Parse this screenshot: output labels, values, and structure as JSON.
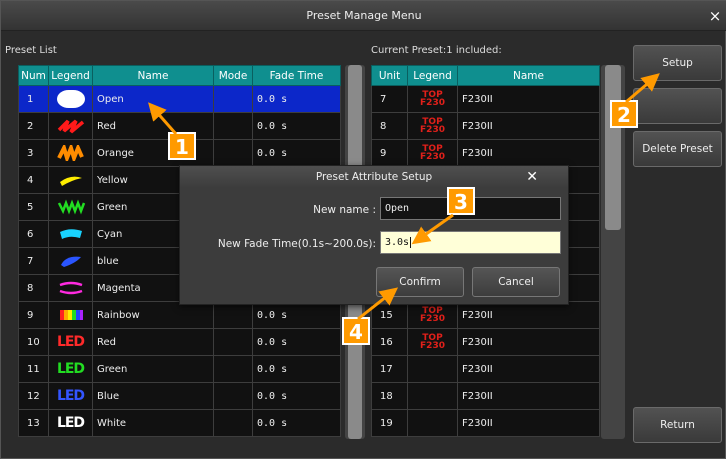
{
  "window": {
    "title": "Preset Manage Menu",
    "close": "×"
  },
  "preset_list": {
    "label": "Preset List",
    "columns": [
      "Num",
      "Legend",
      "Name",
      "Mode",
      "Fade Time"
    ],
    "rows": [
      {
        "num": "1",
        "legend": "white-blob",
        "name": "Open",
        "mode": "",
        "fade": "0.0 s"
      },
      {
        "num": "2",
        "legend": "red-scribble",
        "name": "Red",
        "mode": "",
        "fade": "0.0 s"
      },
      {
        "num": "3",
        "legend": "orange-brush",
        "name": "Orange",
        "mode": "",
        "fade": "0.0 s"
      },
      {
        "num": "4",
        "legend": "yellow-brush",
        "name": "Yellow",
        "mode": "",
        "fade": ""
      },
      {
        "num": "5",
        "legend": "green-scribble",
        "name": "Green",
        "mode": "",
        "fade": ""
      },
      {
        "num": "6",
        "legend": "cyan-brush",
        "name": "Cyan",
        "mode": "",
        "fade": ""
      },
      {
        "num": "7",
        "legend": "blue-brush",
        "name": "blue",
        "mode": "",
        "fade": ""
      },
      {
        "num": "8",
        "legend": "magenta-lips",
        "name": "Magenta",
        "mode": "",
        "fade": ""
      },
      {
        "num": "9",
        "legend": "rainbow",
        "name": "Rainbow",
        "mode": "",
        "fade": "0.0 s"
      },
      {
        "num": "10",
        "legend": "LED",
        "name": "Red",
        "mode": "",
        "fade": "0.0 s"
      },
      {
        "num": "11",
        "legend": "LED",
        "name": "Green",
        "mode": "",
        "fade": "0.0 s"
      },
      {
        "num": "12",
        "legend": "LED",
        "name": "Blue",
        "mode": "",
        "fade": "0.0 s"
      },
      {
        "num": "13",
        "legend": "LED",
        "name": "White",
        "mode": "",
        "fade": "0.0 s"
      }
    ],
    "legend_colors": {
      "red": "#ff2a2a",
      "green": "#22dd22",
      "blue": "#3355ff",
      "white": "#ffffff"
    }
  },
  "current_preset": {
    "label": "Current Preset:1 included:",
    "columns": [
      "Unit",
      "Legend",
      "Name"
    ],
    "rows": [
      {
        "unit": "7",
        "legend": "TOP F230",
        "name": "F230II"
      },
      {
        "unit": "8",
        "legend": "TOP F230",
        "name": "F230II"
      },
      {
        "unit": "9",
        "legend": "TOP F230",
        "name": "F230II"
      },
      {
        "unit": "",
        "legend": "",
        "name": ""
      },
      {
        "unit": "",
        "legend": "",
        "name": ""
      },
      {
        "unit": "",
        "legend": "",
        "name": ""
      },
      {
        "unit": "",
        "legend": "",
        "name": ""
      },
      {
        "unit": "",
        "legend": "",
        "name": ""
      },
      {
        "unit": "15",
        "legend": "TOP F230",
        "name": "F230II"
      },
      {
        "unit": "16",
        "legend": "TOP F230",
        "name": "F230II"
      },
      {
        "unit": "17",
        "legend": "",
        "name": "F230II"
      },
      {
        "unit": "18",
        "legend": "",
        "name": "F230II"
      },
      {
        "unit": "19",
        "legend": "",
        "name": "F230II"
      }
    ]
  },
  "buttons": {
    "setup": "Setup",
    "blank": "",
    "delete_preset": "Delete Preset",
    "return": "Return"
  },
  "dialog": {
    "title": "Preset Attribute Setup",
    "close": "✕",
    "new_name_label": "New name :",
    "new_name_value": "Open",
    "fade_label": "New Fade Time(0.1s~200.0s):",
    "fade_value": "3.0s",
    "confirm": "Confirm",
    "cancel": "Cancel"
  },
  "callouts": [
    "1",
    "2",
    "3",
    "4"
  ],
  "colors": {
    "header": "#0f8f8f",
    "selection": "#0c27c9",
    "callout": "#ff9a00"
  }
}
